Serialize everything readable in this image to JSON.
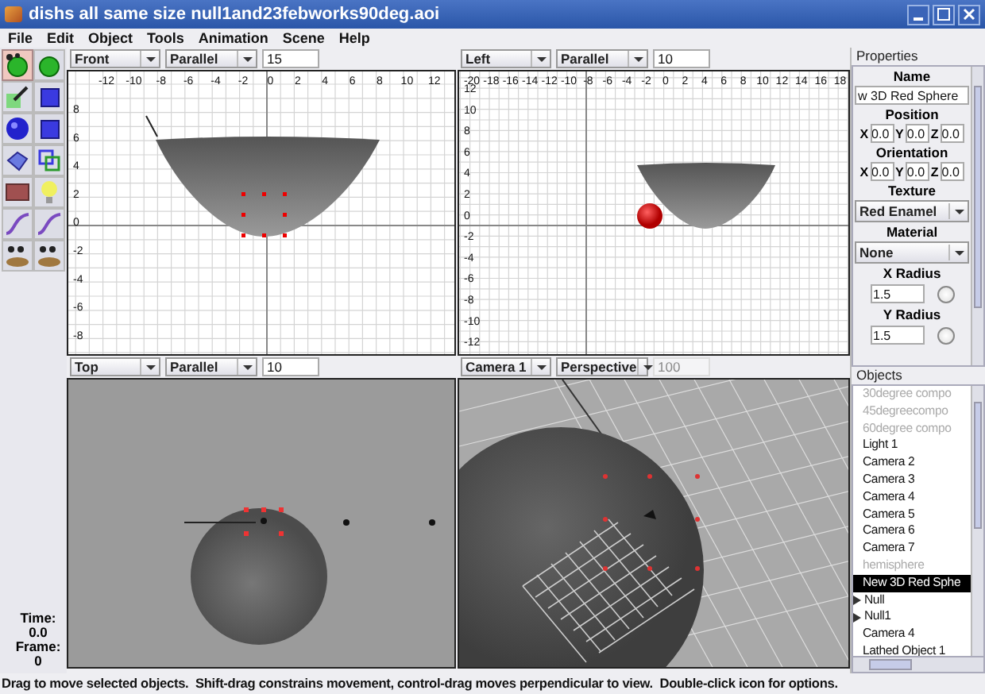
{
  "window": {
    "title": "dishs all same size null1and23febworks90deg.aoi"
  },
  "menu": [
    "File",
    "Edit",
    "Object",
    "Tools",
    "Animation",
    "Scene",
    "Help"
  ],
  "tools": [
    {
      "selected": true
    },
    {
      "selected": false
    },
    {
      "selected": false
    },
    {
      "selected": false
    },
    {
      "selected": false
    },
    {
      "selected": false
    },
    {
      "selected": false
    },
    {
      "selected": false
    },
    {
      "selected": false
    },
    {
      "selected": false
    },
    {
      "selected": false
    },
    {
      "selected": false
    },
    {
      "selected": false
    },
    {
      "selected": false
    }
  ],
  "time": {
    "time_label": "Time:",
    "time": "0.0",
    "frame_label": "Frame:",
    "frame": "0"
  },
  "viewports": [
    {
      "kind": "front",
      "view": "Front",
      "projection": "Parallel",
      "scale": "15",
      "scale_disabled": false,
      "x_ticks": [
        "-12",
        "-10",
        "-8",
        "-6",
        "-4",
        "-2",
        "0",
        "2",
        "4",
        "6",
        "8",
        "10",
        "12"
      ],
      "y_ticks": [
        "8",
        "6",
        "4",
        "2",
        "0",
        "-2",
        "-4",
        "-6",
        "-8"
      ]
    },
    {
      "kind": "left",
      "view": "Left",
      "projection": "Parallel",
      "scale": "10",
      "scale_disabled": false,
      "x_ticks": [
        "-20",
        "-18",
        "-16",
        "-14",
        "-12",
        "-10",
        "-8",
        "-6",
        "-4",
        "-2",
        "0",
        "2",
        "4",
        "6",
        "8",
        "10",
        "12",
        "14",
        "16",
        "18"
      ],
      "y_ticks": [
        "12",
        "10",
        "8",
        "6",
        "4",
        "2",
        "0",
        "-2",
        "-4",
        "-6",
        "-8",
        "-10",
        "-12"
      ]
    },
    {
      "kind": "top",
      "view": "Top",
      "projection": "Parallel",
      "scale": "10",
      "scale_disabled": false
    },
    {
      "kind": "camera",
      "view": "Camera 1",
      "projection": "Perspective",
      "scale": "100",
      "scale_disabled": true
    }
  ],
  "properties": {
    "title": "Properties",
    "name_label": "Name",
    "name_value": "w 3D Red Sphere",
    "position_label": "Position",
    "position": [
      {
        "axis": "X",
        "value": "0.0"
      },
      {
        "axis": "Y",
        "value": "0.0"
      },
      {
        "axis": "Z",
        "value": "0.0"
      }
    ],
    "orientation_label": "Orientation",
    "orientation": [
      {
        "axis": "X",
        "value": "0.0"
      },
      {
        "axis": "Y",
        "value": "0.0"
      },
      {
        "axis": "Z",
        "value": "0.0"
      }
    ],
    "texture_label": "Texture",
    "texture": "Red Enamel",
    "material_label": "Material",
    "material": "None",
    "x_radius_label": "X Radius",
    "x_radius": "1.5",
    "y_radius_label": "Y Radius",
    "y_radius": "1.5"
  },
  "objects": {
    "title": "Objects",
    "items": [
      {
        "label": "30degree compo",
        "kind": "object",
        "hidden": true,
        "selected": false
      },
      {
        "label": "45degreecompo",
        "kind": "object",
        "hidden": true,
        "selected": false
      },
      {
        "label": "60degree compo",
        "kind": "object",
        "hidden": true,
        "selected": false
      },
      {
        "label": "Light 1",
        "kind": "object",
        "hidden": false,
        "selected": false
      },
      {
        "label": "Camera 2",
        "kind": "object",
        "hidden": false,
        "selected": false
      },
      {
        "label": "Camera 3",
        "kind": "object",
        "hidden": false,
        "selected": false
      },
      {
        "label": "Camera 4",
        "kind": "object",
        "hidden": false,
        "selected": false
      },
      {
        "label": "Camera 5",
        "kind": "object",
        "hidden": false,
        "selected": false
      },
      {
        "label": "Camera 6",
        "kind": "object",
        "hidden": false,
        "selected": false
      },
      {
        "label": "Camera 7",
        "kind": "object",
        "hidden": false,
        "selected": false
      },
      {
        "label": "hemisphere",
        "kind": "object",
        "hidden": true,
        "selected": false
      },
      {
        "label": "New 3D Red Sphe",
        "kind": "object",
        "hidden": false,
        "selected": true
      },
      {
        "label": "Null",
        "kind": "group",
        "hidden": false,
        "selected": false
      },
      {
        "label": "Null1",
        "kind": "group",
        "hidden": false,
        "selected": false
      },
      {
        "label": "Camera 4",
        "kind": "object",
        "hidden": false,
        "selected": false
      },
      {
        "label": "Lathed Object 1",
        "kind": "object",
        "hidden": false,
        "selected": false
      }
    ]
  },
  "status_bar": "Drag to move selected objects.  Shift-drag constrains movement, control-drag moves perpendicular to view.  Double-click icon for options."
}
